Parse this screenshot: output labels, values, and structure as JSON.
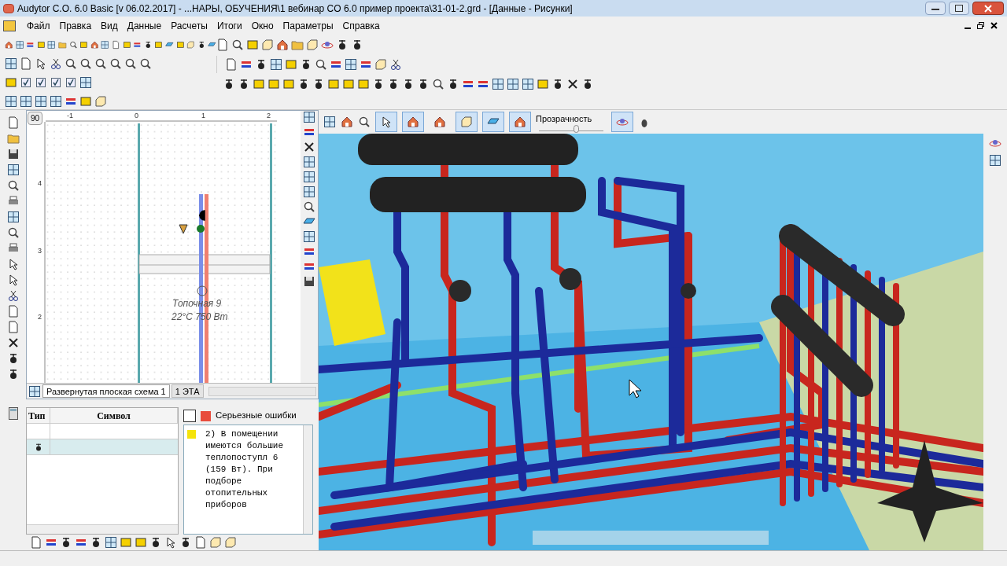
{
  "window": {
    "title": "Audytor C.O. 6.0 Basic [v 06.02.2017] - ...НАРЫ, ОБУЧЕНИЯ\\1 вебинар CO 6.0 пример проекта\\31-01-2.grd - [Данные - Рисунки]"
  },
  "menu": [
    "Файл",
    "Правка",
    "Вид",
    "Данные",
    "Расчеты",
    "Итоги",
    "Окно",
    "Параметры",
    "Справка"
  ],
  "plan": {
    "angle": "90",
    "x_ticks": [
      "-1",
      "0",
      "1",
      "2"
    ],
    "y_ticks": [
      "4",
      "3",
      "2"
    ],
    "room_name": "Топочная 9",
    "room_info": "22°C 750 Вт"
  },
  "sheet_tabs": [
    {
      "label": "Развернутая плоская схема 1",
      "selected": true
    },
    {
      "label": "1 ЭТА",
      "selected": false
    }
  ],
  "symbol_table": {
    "columns": [
      "Тип",
      "Символ"
    ],
    "rows": [
      {
        "selected": false,
        "kind": "empty"
      },
      {
        "selected": true,
        "kind": "valve"
      }
    ]
  },
  "messages": {
    "select_all_checked": false,
    "filter": "Серьезные ошибки",
    "items": [
      {
        "color": "#f5e30a",
        "text": "2) В помещении имеются большие теплопоступл 6 (159 Вт). При подборе отопительных приборов"
      }
    ]
  },
  "view_toolbar": {
    "tools": [
      {
        "kind": "pointer",
        "selected": true
      },
      {
        "kind": "house",
        "selected": true
      },
      {
        "kind": "house",
        "selected": false
      },
      {
        "kind": "box",
        "selected": true
      },
      {
        "kind": "floor",
        "selected": true
      },
      {
        "kind": "house",
        "selected": true
      }
    ],
    "transparency": {
      "label": "Прозрачность",
      "level": 0.58
    },
    "orbit_selected": true
  }
}
